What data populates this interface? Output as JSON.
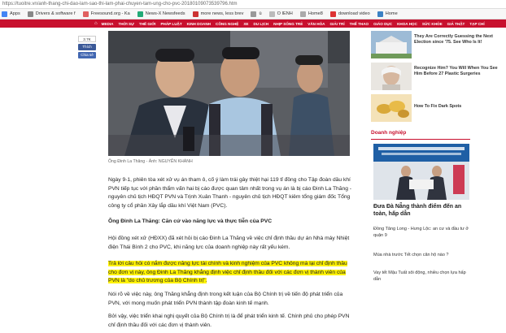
{
  "browser": {
    "address": "https://tuoitre.vn/anh-thang-chi-dao-lam-sao-thi-lam-phai-chuyen-tam-ung-cho-pvc-20180109073539796.htm",
    "bookmarks": [
      "Apps",
      "Drivers & software f",
      "Freesound.org - Ka",
      "News-X Newsfeeds",
      "more news, less brev",
      "ü",
      "O IENH",
      "Home8",
      "download video",
      "Home"
    ]
  },
  "nav": {
    "home_glyph": "⌂",
    "items": [
      "MEDIA",
      "THỜI SỰ",
      "THẾ GIỚI",
      "PHÁP LUẬT",
      "KINH DOANH",
      "CÔNG NGHỆ",
      "XE",
      "DU LỊCH",
      "NHỊP SỐNG TRẺ",
      "VĂN HÓA",
      "GIẢI TRÍ",
      "THỂ THAO",
      "GIÁO DỤC",
      "KHOA HỌC",
      "SỨC KHỎE",
      "GIẢ THẬT",
      "TẠP CHÍ"
    ]
  },
  "share": {
    "count": "3.7K",
    "like": "Thích",
    "save": "Chia sẻ"
  },
  "photo_caption": "Ông Đinh La Thăng - Ảnh: NGUYỄN KHÁNH",
  "article": {
    "p1": "Ngày 9-1, phiên tòa xét xử vụ án tham ô, cố ý làm trái gây thiệt hại 119 tỉ đồng cho Tập đoàn dầu khí PVN tiếp tục với phần thẩm vấn hai bị cáo được quan tâm nhất trong vụ án là bị cáo Đinh La Thăng - nguyên chủ tịch HĐQT PVN và Trịnh Xuân Thanh - nguyên chủ tịch HĐQT kiêm tổng giám đốc Tổng công ty cổ phần Xây lắp dầu khí Việt Nam (PVC).",
    "heading": "Ông Đinh La Thăng: Căn cứ vào năng lực và thực tiễn của PVC",
    "p2": "Hội đồng xét xử (HĐXX) đã xét hỏi bị cáo Đinh La Thăng về việc chỉ định thầu dự án Nhà máy Nhiệt điện Thái Bình 2 cho PVC, khi năng lực của doanh nghiệp này rất yếu kém.",
    "p3": "Trả lời câu hỏi có nắm được năng lực tài chính và kinh nghiệm của PVC không mà lại chỉ định thầu cho đơn vị này, ông Đinh La Thăng khẳng định việc chỉ định thầu đối với các đơn vị thành viên của PVN là \"do chủ trương của Bộ Chính trị\".",
    "p4": "Nói rõ về việc này, ông Thăng khẳng định trong kết luận của Bộ Chính trị về tiến độ phát triển của PVN, với mong muốn phát triển PVN thành tập đoàn kinh tế mạnh.",
    "p5": "Bởi vậy, việc triển khai nghị quyết của Bộ Chính trị là để phát triển kinh tế. Chính phủ cho phép PVN chỉ định thầu đối với các đơn vị thành viên."
  },
  "ads": [
    {
      "title": "They Are Correctly Guessing the Next Election since '75. See Who Is It!"
    },
    {
      "title": "Recognize Him? You Will When You See Him Before 27 Plastic Surgeries"
    },
    {
      "title": "How To Fix Dark Spots"
    }
  ],
  "sidebar": {
    "section": "Doanh nghiệp",
    "headline": "Đưa Đà Nẵng thành điểm đến an toàn, hấp dẫn",
    "links": [
      "Đồng Tâng Long - Hưng Lộc: an cư và đầu tư ở quận 9",
      "Mùa nhà trước Tết chọn căn hộ nào ?",
      "Vay tết Mậu Tuất sôi động, nhiều chọn lựa hấp dẫn"
    ]
  },
  "colors": {
    "brand": "#c8102e",
    "highlight": "#fff200"
  }
}
